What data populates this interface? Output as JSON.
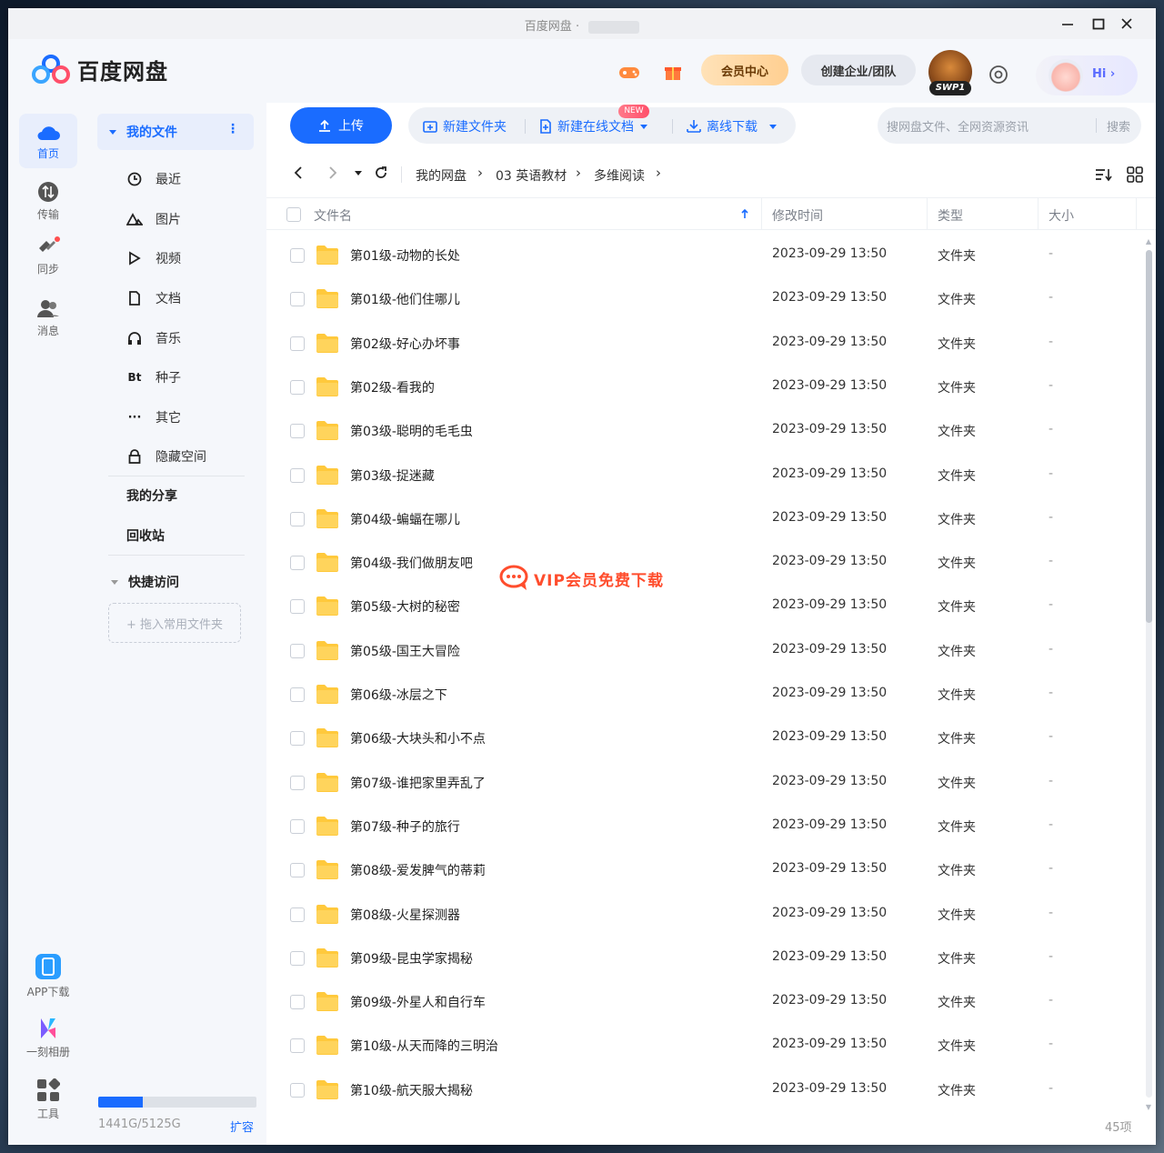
{
  "window": {
    "title": "百度网盘",
    "title_sep": "·"
  },
  "header": {
    "logo_text": "百度网盘",
    "vip_center": "会员中心",
    "create_team": "创建企业/团队",
    "avatar_badge": "SWP1",
    "hi": "Hi",
    "hi_arrow": "›"
  },
  "rail": {
    "home": "首页",
    "transfer": "传输",
    "sync": "同步",
    "messages": "消息",
    "app_download": "APP下载",
    "album": "一刻相册",
    "tools": "工具"
  },
  "nav": {
    "my_files": "我的文件",
    "items": [
      {
        "label": "最近",
        "icon": "clock-icon"
      },
      {
        "label": "图片",
        "icon": "image-icon"
      },
      {
        "label": "视频",
        "icon": "play-icon"
      },
      {
        "label": "文档",
        "icon": "document-icon"
      },
      {
        "label": "音乐",
        "icon": "headphones-icon"
      },
      {
        "label": "种子",
        "icon": "bt-icon",
        "glyph": "Bt"
      },
      {
        "label": "其它",
        "icon": "more-icon",
        "glyph": "···"
      },
      {
        "label": "隐藏空间",
        "icon": "lock-icon"
      }
    ],
    "my_share": "我的分享",
    "recycle": "回收站",
    "quick_access": "快捷访问",
    "drop_hint": "+ 拖入常用文件夹",
    "quota_text": "1441G/5125G",
    "quota_fraction": 0.281,
    "expand": "扩容"
  },
  "toolbar": {
    "upload": "上传",
    "new_folder": "新建文件夹",
    "new_doc": "新建在线文档",
    "new_badge": "NEW",
    "offline_download": "离线下载",
    "search_placeholder": "搜网盘文件、全网资源资讯",
    "search_button": "搜索"
  },
  "breadcrumb": [
    "我的网盘",
    "03 英语教材",
    "多维阅读"
  ],
  "table": {
    "col_name": "文件名",
    "col_time": "修改时间",
    "col_type": "类型",
    "col_size": "大小",
    "rows": [
      {
        "name": "第01级-动物的长处",
        "time": "2023-09-29 13:50",
        "type": "文件夹",
        "size": "-"
      },
      {
        "name": "第01级-他们住哪儿",
        "time": "2023-09-29 13:50",
        "type": "文件夹",
        "size": "-"
      },
      {
        "name": "第02级-好心办坏事",
        "time": "2023-09-29 13:50",
        "type": "文件夹",
        "size": "-"
      },
      {
        "name": "第02级-看我的",
        "time": "2023-09-29 13:50",
        "type": "文件夹",
        "size": "-"
      },
      {
        "name": "第03级-聪明的毛毛虫",
        "time": "2023-09-29 13:50",
        "type": "文件夹",
        "size": "-"
      },
      {
        "name": "第03级-捉迷藏",
        "time": "2023-09-29 13:50",
        "type": "文件夹",
        "size": "-"
      },
      {
        "name": "第04级-蝙蝠在哪儿",
        "time": "2023-09-29 13:50",
        "type": "文件夹",
        "size": "-"
      },
      {
        "name": "第04级-我们做朋友吧",
        "time": "2023-09-29 13:50",
        "type": "文件夹",
        "size": "-"
      },
      {
        "name": "第05级-大树的秘密",
        "time": "2023-09-29 13:50",
        "type": "文件夹",
        "size": "-"
      },
      {
        "name": "第05级-国王大冒险",
        "time": "2023-09-29 13:50",
        "type": "文件夹",
        "size": "-"
      },
      {
        "name": "第06级-冰层之下",
        "time": "2023-09-29 13:50",
        "type": "文件夹",
        "size": "-"
      },
      {
        "name": "第06级-大块头和小不点",
        "time": "2023-09-29 13:50",
        "type": "文件夹",
        "size": "-"
      },
      {
        "name": "第07级-谁把家里弄乱了",
        "time": "2023-09-29 13:50",
        "type": "文件夹",
        "size": "-"
      },
      {
        "name": "第07级-种子的旅行",
        "time": "2023-09-29 13:50",
        "type": "文件夹",
        "size": "-"
      },
      {
        "name": "第08级-爱发脾气的蒂莉",
        "time": "2023-09-29 13:50",
        "type": "文件夹",
        "size": "-"
      },
      {
        "name": "第08级-火星探测器",
        "time": "2023-09-29 13:50",
        "type": "文件夹",
        "size": "-"
      },
      {
        "name": "第09级-昆虫学家揭秘",
        "time": "2023-09-29 13:50",
        "type": "文件夹",
        "size": "-"
      },
      {
        "name": "第09级-外星人和自行车",
        "time": "2023-09-29 13:50",
        "type": "文件夹",
        "size": "-"
      },
      {
        "name": "第10级-从天而降的三明治",
        "time": "2023-09-29 13:50",
        "type": "文件夹",
        "size": "-"
      },
      {
        "name": "第10级-航天服大揭秘",
        "time": "2023-09-29 13:50",
        "type": "文件夹",
        "size": "-"
      }
    ],
    "item_count": "45项"
  },
  "watermark": "VIP会员免费下载",
  "colors": {
    "accent": "#1a6cff",
    "folder": "#ffc93c",
    "vip": "#ffcf91"
  }
}
